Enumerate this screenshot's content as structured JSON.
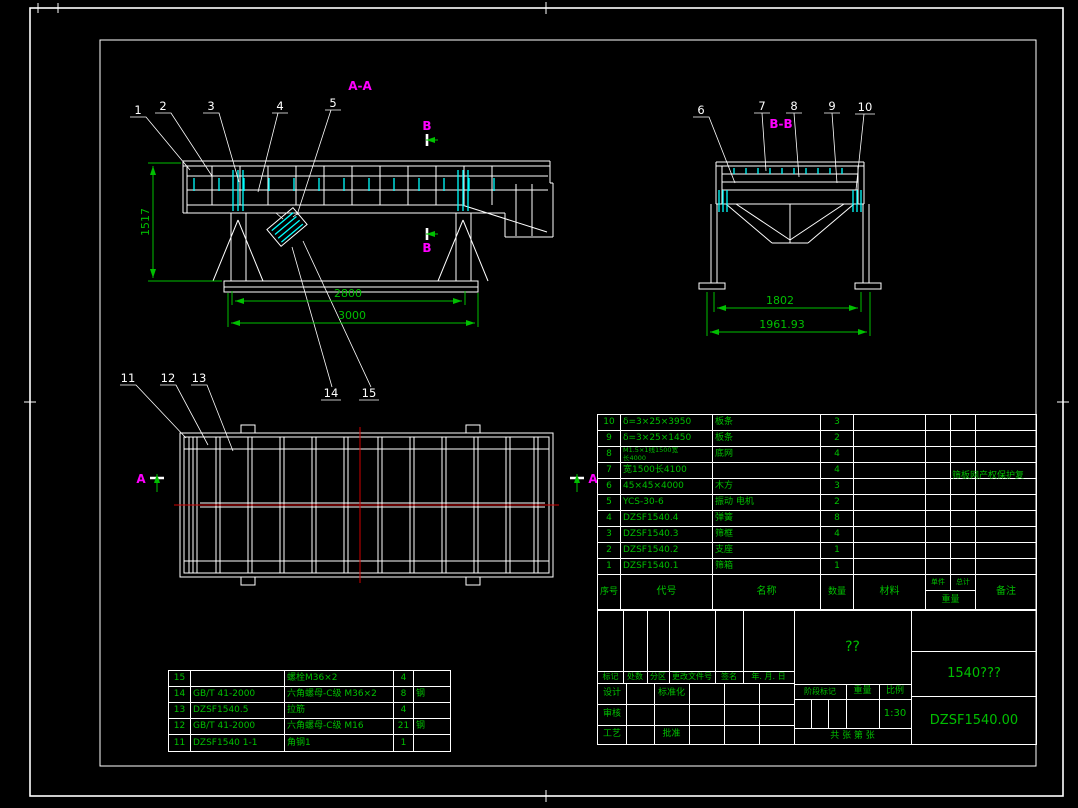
{
  "colors": {
    "background": "#000000",
    "line": "#ffffff",
    "annotation": "#00bf00",
    "section_label": "#ff00ff",
    "detail": "#00ffff",
    "centerline": "#d00000"
  },
  "sections": {
    "aa": "A-A",
    "bb": "B-B",
    "a_left": "A",
    "a_right": "A",
    "b_top": "B",
    "b_bottom": "B"
  },
  "callouts": {
    "c1": "1",
    "c2": "2",
    "c3": "3",
    "c4": "4",
    "c5": "5",
    "c6": "6",
    "c7": "7",
    "c8": "8",
    "c9": "9",
    "c10": "10",
    "c11": "11",
    "c12": "12",
    "c13": "13",
    "c14": "14",
    "c15": "15"
  },
  "dims": {
    "side_height": "1517",
    "side_width_inner": "2800",
    "side_width_outer": "3000",
    "end_width_inner": "1802",
    "end_width_outer": "1961.93"
  },
  "bom": {
    "header": {
      "no": "序号",
      "code": "代号",
      "name": "名称",
      "qty": "数量",
      "material": "材料",
      "unit": "单件",
      "total": "总计",
      "weight": "重量",
      "remark": "备注"
    },
    "note": "筛板网产权保护复",
    "rows": [
      {
        "no": "10",
        "code": "δ=3×25×3950",
        "name": "板条",
        "qty": "3"
      },
      {
        "no": "9",
        "code": "δ=3×25×1450",
        "name": "板条",
        "qty": "2"
      },
      {
        "no": "8",
        "code": "M1.5×1线1500宽",
        "code2": "长4000",
        "name": "底网",
        "qty": "4"
      },
      {
        "no": "7",
        "code": "宽1500长4100",
        "name": "",
        "qty": "4"
      },
      {
        "no": "6",
        "code": "45×45×4000",
        "name": "木方",
        "qty": "3"
      },
      {
        "no": "5",
        "code": "YCS-30-6",
        "name": "振动 电机",
        "qty": "2"
      },
      {
        "no": "4",
        "code": "DZSF1540.4",
        "name": "弹簧",
        "qty": "8"
      },
      {
        "no": "3",
        "code": "DZSF1540.3",
        "name": "筛框",
        "qty": "4"
      },
      {
        "no": "2",
        "code": "DZSF1540.2",
        "name": "支座",
        "qty": "1"
      },
      {
        "no": "1",
        "code": "DZSF1540.1",
        "name": "筛箱",
        "qty": "1"
      }
    ]
  },
  "parts_table": {
    "rows": [
      {
        "no": "15",
        "code": "",
        "name": "螺栓M36×2",
        "qty": "4",
        "material": ""
      },
      {
        "no": "14",
        "code": "GB/T 41-2000",
        "name": "六角螺母-C级 M36×2",
        "qty": "8",
        "material": "钢"
      },
      {
        "no": "13",
        "code": "DZSF1540.5",
        "name": "拉筋",
        "qty": "4",
        "material": ""
      },
      {
        "no": "12",
        "code": "GB/T 41-2000",
        "name": "六角螺母-C级 M16",
        "qty": "21",
        "material": "钢"
      },
      {
        "no": "11",
        "code": "DZSF1540 1-1",
        "name": "角钢1",
        "qty": "1",
        "material": ""
      }
    ]
  },
  "title_block": {
    "company": "??",
    "drawing_name": "1540???",
    "drawing_no": "DZSF1540.00",
    "scale_value": "1:30",
    "labels": {
      "mark": "标记",
      "count": "处数",
      "zone": "分区",
      "change_doc": "更改文件号",
      "sign": "签名",
      "date": "年. 月. 日",
      "design": "设计",
      "standardization": "标准化",
      "check": "审核",
      "process": "工艺",
      "approve": "批准",
      "stage_mark": "阶段标记",
      "weight": "重量",
      "scale": "比例",
      "sheet": "共  张  第  张"
    }
  }
}
